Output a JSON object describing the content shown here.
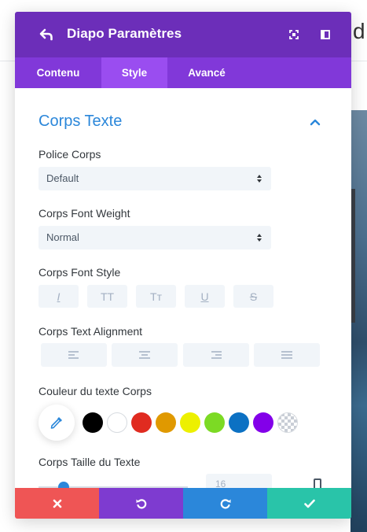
{
  "background": {
    "partial_heading_letter": "d"
  },
  "header": {
    "title": "Diapo Paramètres",
    "back_icon": "back-arrow-icon",
    "expand_icon": "expand-icon",
    "split_icon": "sidebar-split-icon",
    "color": "#6c2eb9"
  },
  "tabs": [
    {
      "label": "Contenu",
      "active": false
    },
    {
      "label": "Style",
      "active": true
    },
    {
      "label": "Avancé",
      "active": false
    }
  ],
  "section": {
    "title": "Corps Texte",
    "collapse_icon": "chevron-up-icon"
  },
  "fields": {
    "font": {
      "label": "Police Corps",
      "value": "Default"
    },
    "weight": {
      "label": "Corps Font Weight",
      "value": "Normal"
    },
    "style": {
      "label": "Corps Font Style",
      "buttons": [
        {
          "name": "italic",
          "glyph": "I"
        },
        {
          "name": "uppercase",
          "glyph": "TT"
        },
        {
          "name": "capitalize",
          "glyph": "Tт"
        },
        {
          "name": "underline",
          "glyph": "U"
        },
        {
          "name": "strikethrough",
          "glyph": "S"
        }
      ]
    },
    "alignment": {
      "label": "Corps Text Alignment",
      "buttons": [
        "left",
        "center",
        "right",
        "justify"
      ]
    },
    "color": {
      "label": "Couleur du texte Corps",
      "picker_icon": "eyedropper-icon",
      "swatches": [
        "#000000",
        "#ffffff",
        "#e02b20",
        "#e09900",
        "#edf000",
        "#7cda24",
        "#0c71c3",
        "#8300e9",
        "transparent"
      ]
    },
    "size": {
      "label": "Corps Taille du Texte",
      "value": "16",
      "device_icon": "mobile-device-icon"
    }
  },
  "footer": {
    "cancel_icon": "close-icon",
    "undo_icon": "undo-icon",
    "redo_icon": "redo-icon",
    "save_icon": "check-icon",
    "colors": {
      "cancel": "#ef5555",
      "undo": "#7e3bd0",
      "redo": "#2b87da",
      "save": "#29c4a9"
    }
  }
}
